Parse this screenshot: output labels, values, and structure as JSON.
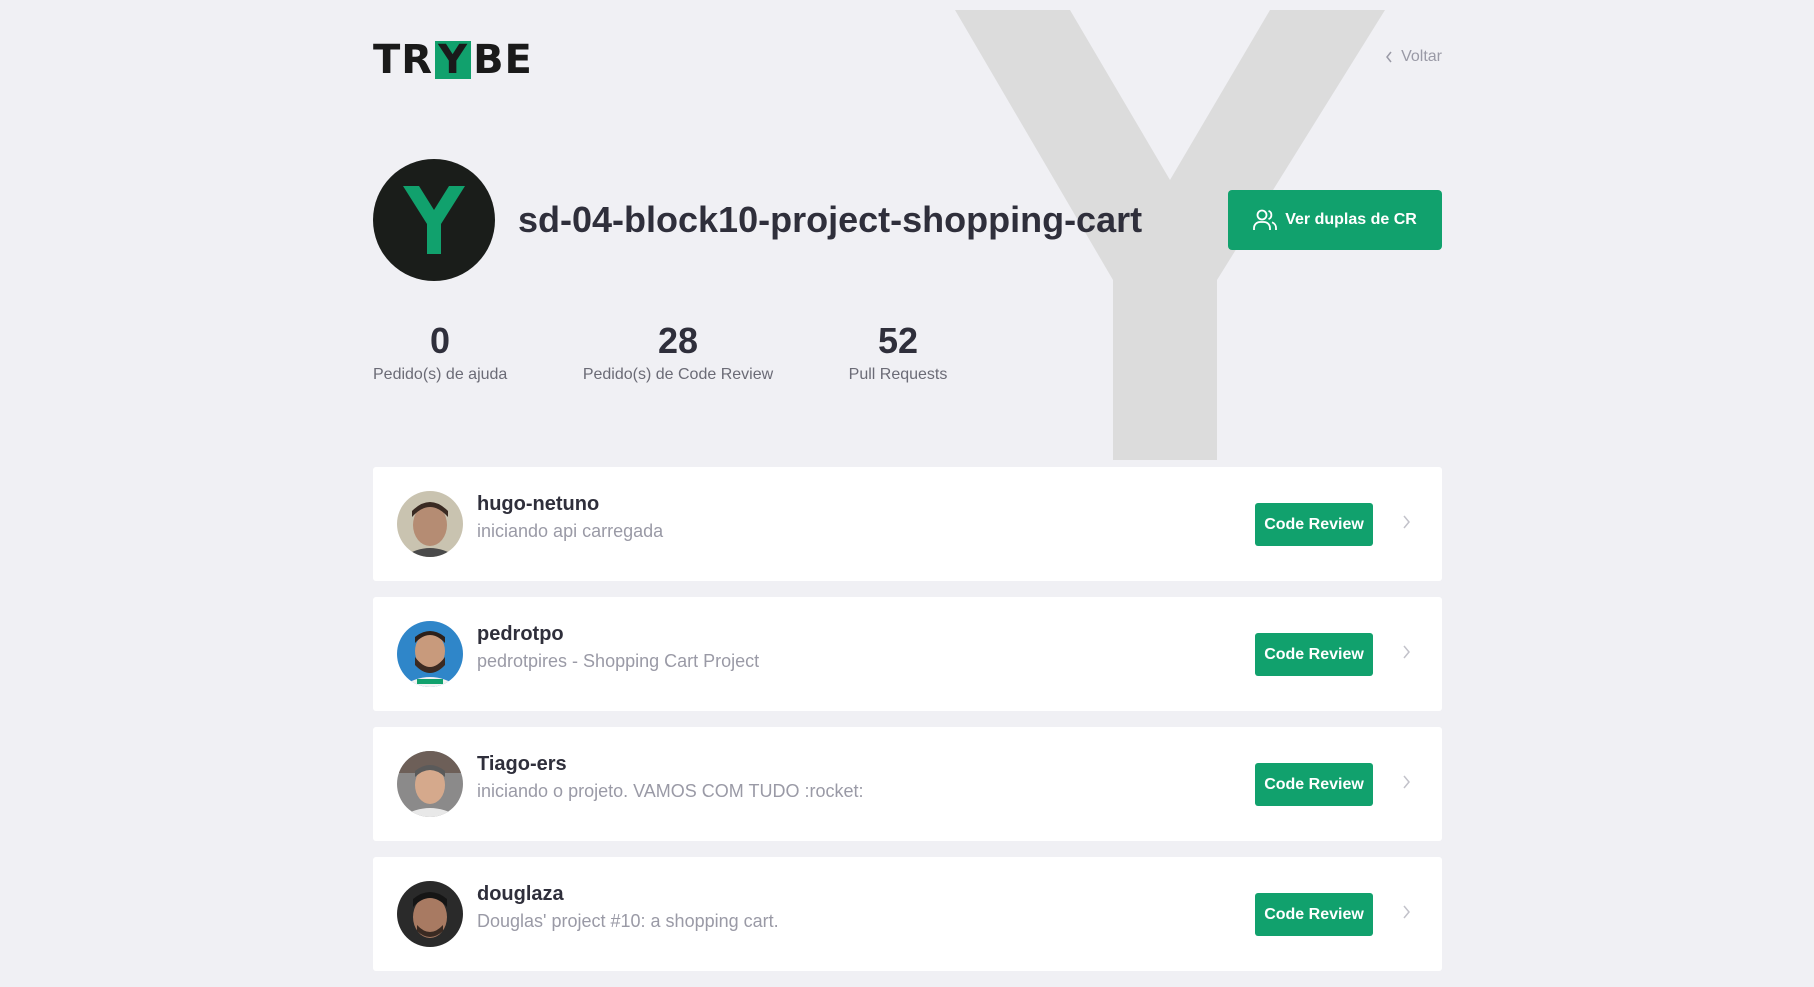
{
  "header": {
    "logo": {
      "left": "TR",
      "y": "Y",
      "right": "BE"
    },
    "back_label": "Voltar"
  },
  "project": {
    "title": "sd-04-block10-project-shopping-cart",
    "pairs_button_label": "Ver duplas de CR"
  },
  "stats": [
    {
      "value": "0",
      "label": "Pedido(s) de ajuda"
    },
    {
      "value": "28",
      "label": "Pedido(s) de Code Review"
    },
    {
      "value": "52",
      "label": "Pull Requests"
    }
  ],
  "pull_requests": [
    {
      "user": "hugo-netuno",
      "message": "iniciando api carregada",
      "button": "Code Review"
    },
    {
      "user": "pedrotpo",
      "message": "pedrotpires - Shopping Cart Project",
      "button": "Code Review"
    },
    {
      "user": "Tiago-ers",
      "message": "iniciando o projeto. VAMOS COM TUDO :rocket:",
      "button": "Code Review"
    },
    {
      "user": "douglaza",
      "message": "Douglas' project #10: a shopping cart.",
      "button": "Code Review"
    }
  ],
  "colors": {
    "accent": "#11a16d",
    "background": "#f0f0f4",
    "card": "#ffffff",
    "title": "#2f2f3b",
    "muted": "#9a9aa6"
  },
  "icons": {
    "back": "chevron-left-icon",
    "pairs": "users-icon",
    "row_arrow": "chevron-right-icon"
  }
}
